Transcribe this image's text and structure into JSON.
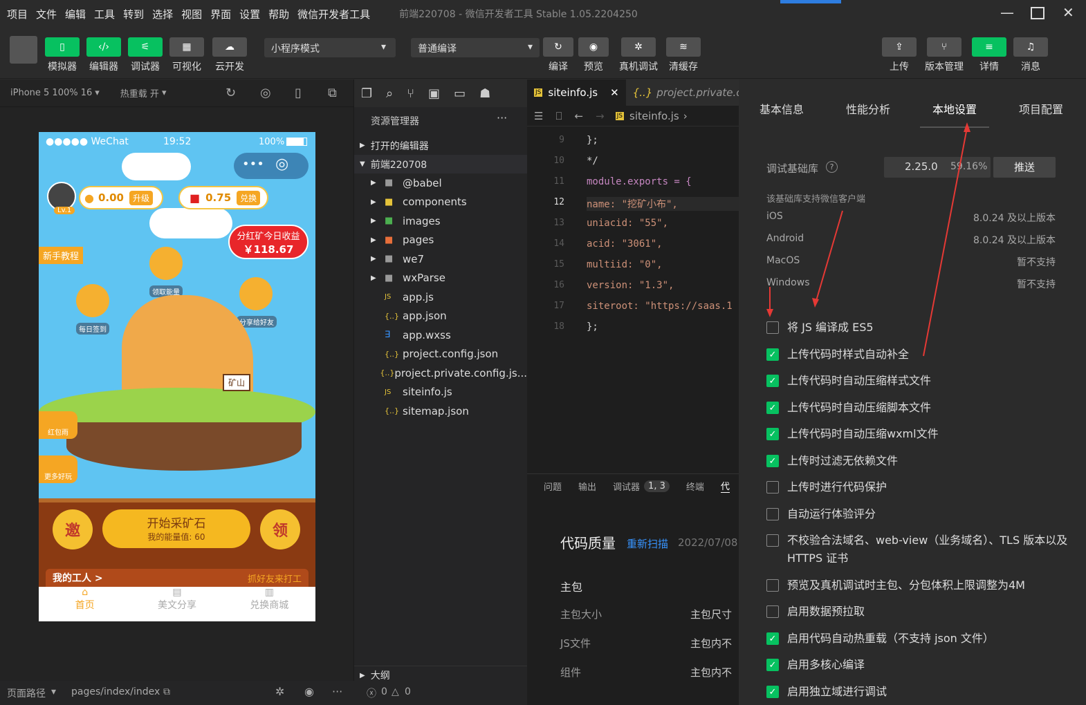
{
  "menu": {
    "items": [
      "项目",
      "文件",
      "编辑",
      "工具",
      "转到",
      "选择",
      "视图",
      "界面",
      "设置",
      "帮助",
      "微信开发者工具"
    ],
    "title": "前端220708 - 微信开发者工具 Stable 1.05.2204250"
  },
  "toolbar": {
    "simulator": "模拟器",
    "editor": "编辑器",
    "debugger": "调试器",
    "visual": "可视化",
    "cloud": "云开发",
    "mode": "小程序模式",
    "compile_mode": "普通编译",
    "compile": "编译",
    "preview": "预览",
    "real_debug": "真机调试",
    "clear_cache": "清缓存",
    "upload": "上传",
    "version": "版本管理",
    "details": "详情",
    "messages": "消息"
  },
  "sim": {
    "device": "iPhone 5 100% 16",
    "hot_reload": "热重载 开",
    "carrier": "●●●●● WeChat",
    "time": "19:52",
    "battery": "100%",
    "coin": "0.00",
    "upgrade": "升级",
    "red": "0.75",
    "exchange": "兑换",
    "level": "Lv.1",
    "dividend_title": "分红矿今日收益",
    "dividend_value": "￥118.67",
    "newbie": "新手教程",
    "collect": "领取能量",
    "checkin": "每日签到",
    "share": "分享给好友",
    "mine_sign": "矿山",
    "redpack": "红包雨",
    "more": "更多好玩",
    "invite": "邀",
    "start": "开始采矿石",
    "energy": "我的能量值: 60",
    "claim": "领",
    "workers": "我的工人 >",
    "hire": "抓好友来打工",
    "tab_home": "首页",
    "tab_share": "美文分享",
    "tab_mall": "兑换商城"
  },
  "explorer": {
    "title": "资源管理器",
    "open_editors": "打开的编辑器",
    "project": "前端220708",
    "files": [
      "@babel",
      "components",
      "images",
      "pages",
      "we7",
      "wxParse",
      "app.js",
      "app.json",
      "app.wxss",
      "project.config.json",
      "project.private.config.js...",
      "siteinfo.js",
      "sitemap.json"
    ],
    "outline": "大纲"
  },
  "editor": {
    "tab1": "siteinfo.js",
    "tab2": "project.private.co",
    "breadcrumb": "siteinfo.js",
    "lines": [
      {
        "n": "9",
        "t": "};"
      },
      {
        "n": "10",
        "t": "*/"
      },
      {
        "n": "11",
        "t": "module.exports = {"
      },
      {
        "n": "12",
        "t": "  name: \"挖矿小布\","
      },
      {
        "n": "13",
        "t": "  uniacid: \"55\","
      },
      {
        "n": "14",
        "t": "  acid: \"3061\","
      },
      {
        "n": "15",
        "t": "  multiid: \"0\","
      },
      {
        "n": "16",
        "t": "  version: \"1.3\","
      },
      {
        "n": "17",
        "t": "  siteroot: \"https://saas.1"
      },
      {
        "n": "18",
        "t": "};"
      }
    ]
  },
  "panel": {
    "tabs": [
      "问题",
      "输出",
      "调试器",
      "1, 3",
      "终端",
      "代"
    ],
    "title": "代码质量",
    "rescan": "重新扫描",
    "date": "2022/07/08",
    "main_pkg": "主包",
    "rows": [
      {
        "k": "主包大小",
        "v": "主包尺寸"
      },
      {
        "k": "JS文件",
        "v": "主包内不"
      },
      {
        "k": "组件",
        "v": "主包内不"
      }
    ]
  },
  "right": {
    "tabs": [
      "基本信息",
      "性能分析",
      "本地设置",
      "项目配置"
    ],
    "lib_label": "调试基础库",
    "lib_version": "2.25.0",
    "lib_pct": "59.16%",
    "push": "推送",
    "support": "该基础库支持微信客户端",
    "os": [
      {
        "k": "iOS",
        "v": "8.0.24 及以上版本"
      },
      {
        "k": "Android",
        "v": "8.0.24 及以上版本"
      },
      {
        "k": "MacOS",
        "v": "暂不支持"
      },
      {
        "k": "Windows",
        "v": "暂不支持"
      }
    ],
    "options": [
      {
        "label": "将 JS 编译成 ES5",
        "on": false
      },
      {
        "label": "上传代码时样式自动补全",
        "on": true
      },
      {
        "label": "上传代码时自动压缩样式文件",
        "on": true
      },
      {
        "label": "上传代码时自动压缩脚本文件",
        "on": true
      },
      {
        "label": "上传代码时自动压缩wxml文件",
        "on": true
      },
      {
        "label": "上传时过滤无依赖文件",
        "on": true
      },
      {
        "label": "上传时进行代码保护",
        "on": false
      },
      {
        "label": "自动运行体验评分",
        "on": false
      },
      {
        "label": "不校验合法域名、web-view（业务域名）、TLS 版本以及 HTTPS 证书",
        "on": false
      },
      {
        "label": "预览及真机调试时主包、分包体积上限调整为4M",
        "on": false
      },
      {
        "label": "启用数据预拉取",
        "on": false
      },
      {
        "label": "启用代码自动热重载（不支持 json 文件）",
        "on": true
      },
      {
        "label": "启用多核心编译",
        "on": true
      },
      {
        "label": "启用独立域进行调试",
        "on": true
      }
    ]
  },
  "status": {
    "path_label": "页面路径",
    "path": "pages/index/index",
    "errors": "0",
    "warnings": "0"
  }
}
